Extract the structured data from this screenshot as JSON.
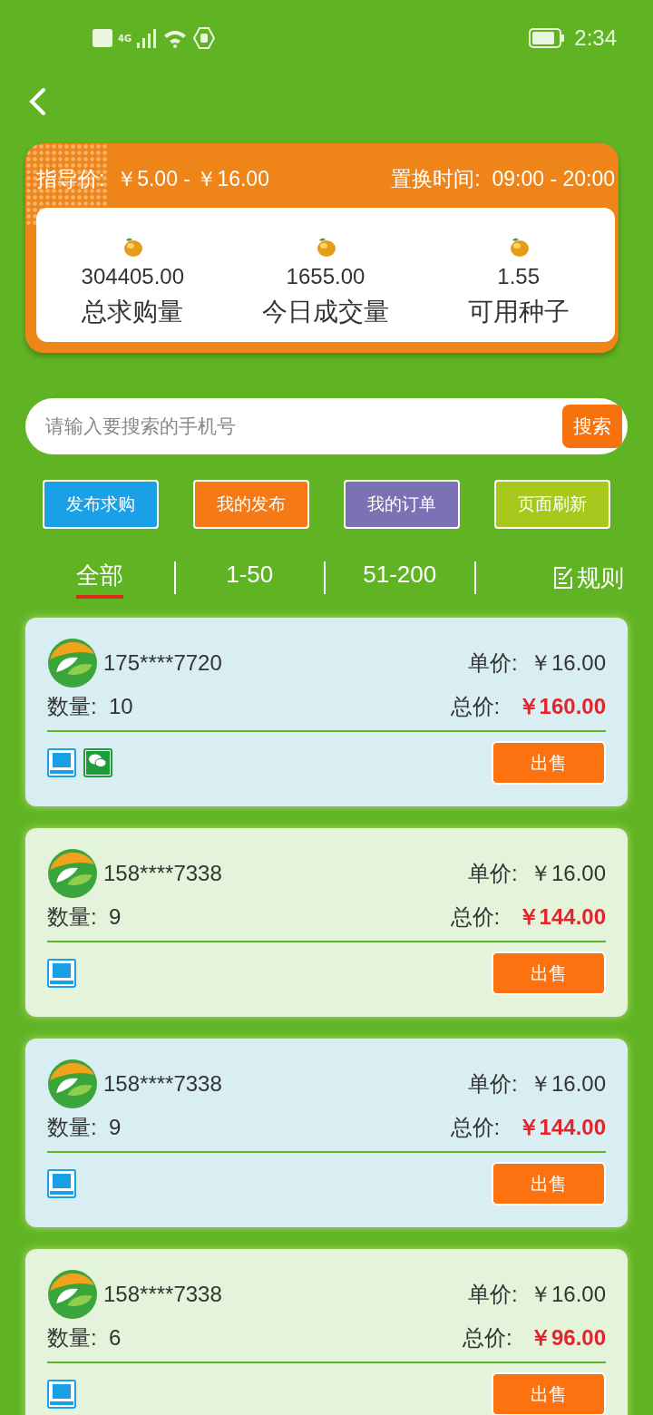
{
  "status_bar": {
    "network": "4G",
    "time": "2:34"
  },
  "header": {
    "guide_label": "指导价:",
    "guide_value": "￥5.00 - ￥16.00",
    "time_label": "置换时间:",
    "time_value": "09:00 - 20:00",
    "stats": [
      {
        "value": "304405.00",
        "label": "总求购量"
      },
      {
        "value": "1655.00",
        "label": "今日成交量"
      },
      {
        "value": "1.55",
        "label": "可用种子"
      }
    ]
  },
  "search": {
    "placeholder": "请输入要搜索的手机号",
    "button": "搜索"
  },
  "actions": [
    {
      "label": "发布求购",
      "color": "#1aa0e6"
    },
    {
      "label": "我的发布",
      "color": "#f57a16"
    },
    {
      "label": "我的订单",
      "color": "#7a72b4"
    },
    {
      "label": "页面刷新",
      "color": "#a8c81e"
    }
  ],
  "tabs": [
    {
      "label": "全部",
      "selected": true
    },
    {
      "label": "1-50",
      "selected": false
    },
    {
      "label": "51-200",
      "selected": false
    }
  ],
  "rules": "规则",
  "orders": [
    {
      "phone": "175****7720",
      "price_label": "单价:",
      "price": "￥16.00",
      "qty_label": "数量:",
      "qty": "10",
      "total_label": "总价:",
      "total": "￥160.00",
      "color": "#d9eef2",
      "payments": [
        {
          "kind": "square"
        },
        {
          "kind": "chat"
        }
      ],
      "button": "出售"
    },
    {
      "phone": "158****7338",
      "price_label": "单价:",
      "price": "￥16.00",
      "qty_label": "数量:",
      "qty": "9",
      "total_label": "总价:",
      "total": "￥144.00",
      "color": "#e3f4db",
      "payments": [
        {
          "kind": "square"
        }
      ],
      "button": "出售"
    },
    {
      "phone": "158****7338",
      "price_label": "单价:",
      "price": "￥16.00",
      "qty_label": "数量:",
      "qty": "9",
      "total_label": "总价:",
      "total": "￥144.00",
      "color": "#d9eef2",
      "payments": [
        {
          "kind": "square"
        }
      ],
      "button": "出售"
    },
    {
      "phone": "158****7338",
      "price_label": "单价:",
      "price": "￥16.00",
      "qty_label": "数量:",
      "qty": "6",
      "total_label": "总价:",
      "total": "￥96.00",
      "color": "#e3f4db",
      "payments": [
        {
          "kind": "square"
        }
      ],
      "button": "出售"
    }
  ]
}
